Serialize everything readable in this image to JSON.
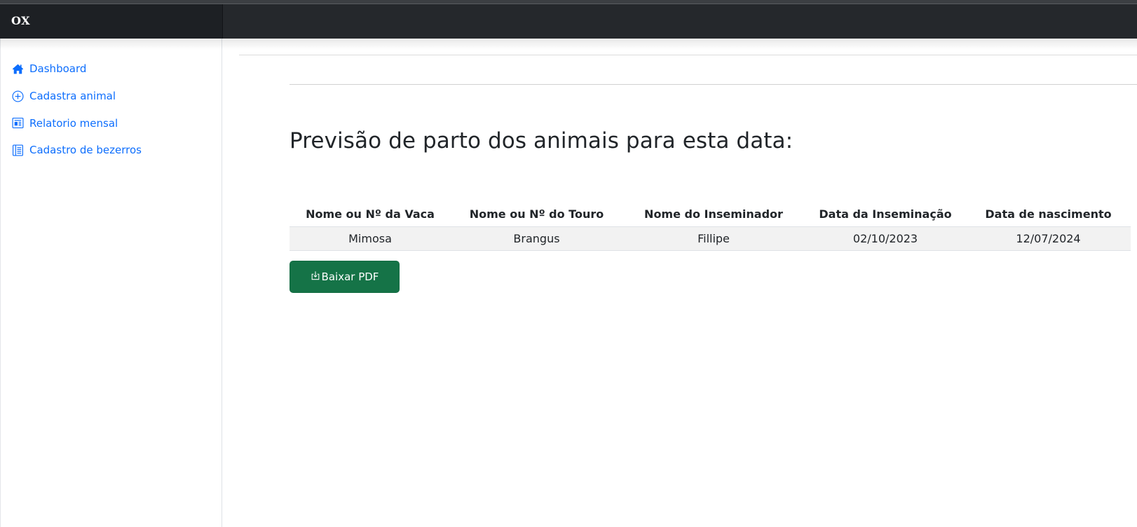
{
  "navbar": {
    "brand": "OX"
  },
  "sidebar": {
    "items": [
      {
        "label": "Dashboard",
        "icon": "house-icon"
      },
      {
        "label": "Cadastra animal",
        "icon": "plus-circle-icon"
      },
      {
        "label": "Relatorio mensal",
        "icon": "newspaper-icon"
      },
      {
        "label": "Cadastro de bezerros",
        "icon": "journal-icon"
      }
    ]
  },
  "main": {
    "title": "Previsão de parto dos animais para esta data:",
    "table": {
      "headers": [
        "Nome ou Nº da Vaca",
        "Nome ou Nº do Touro",
        "Nome do Inseminador",
        "Data da Inseminação",
        "Data de nascimento"
      ],
      "rows": [
        [
          "Mimosa",
          "Brangus",
          "Fillipe",
          "02/10/2023",
          "12/07/2024"
        ]
      ]
    },
    "pdf_button": {
      "label": "Baixar PDF",
      "icon": "download-icon"
    }
  },
  "colors": {
    "navbar_bg": "#25282c",
    "link": "#0d6efd",
    "button_bg": "#157347",
    "row_bg": "#f2f2f2"
  }
}
